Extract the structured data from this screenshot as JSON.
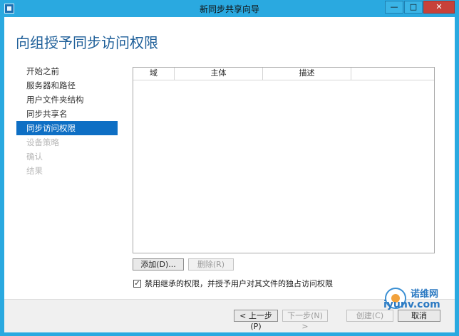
{
  "window": {
    "title": "新同步共享向导",
    "controls": {
      "minimize": "—",
      "maximize": "□",
      "close": "✕"
    }
  },
  "page": {
    "heading": "向组授予同步访问权限"
  },
  "steps": [
    {
      "label": "开始之前",
      "state": "normal"
    },
    {
      "label": "服务器和路径",
      "state": "normal"
    },
    {
      "label": "用户文件夹结构",
      "state": "normal"
    },
    {
      "label": "同步共享名",
      "state": "normal"
    },
    {
      "label": "同步访问权限",
      "state": "active"
    },
    {
      "label": "设备策略",
      "state": "disabled"
    },
    {
      "label": "确认",
      "state": "disabled"
    },
    {
      "label": "结果",
      "state": "disabled"
    }
  ],
  "table": {
    "columns": [
      "域",
      "主体",
      "描述",
      ""
    ]
  },
  "buttons": {
    "add": "添加(D)...",
    "remove": "删除(R)"
  },
  "checkbox": {
    "checked": true,
    "label": "禁用继承的权限，并授予用户对其文件的独占访问权限"
  },
  "footer": {
    "prev": "< 上一步(P)",
    "next": "下一步(N) >",
    "create": "创建(C)",
    "cancel": "取消"
  },
  "watermark": {
    "top": "诺维网",
    "bottom": "iyunv.com"
  },
  "colors": {
    "titlebar": "#2aa9e0",
    "heading": "#1e5f99",
    "active_step": "#0e6fc4"
  }
}
